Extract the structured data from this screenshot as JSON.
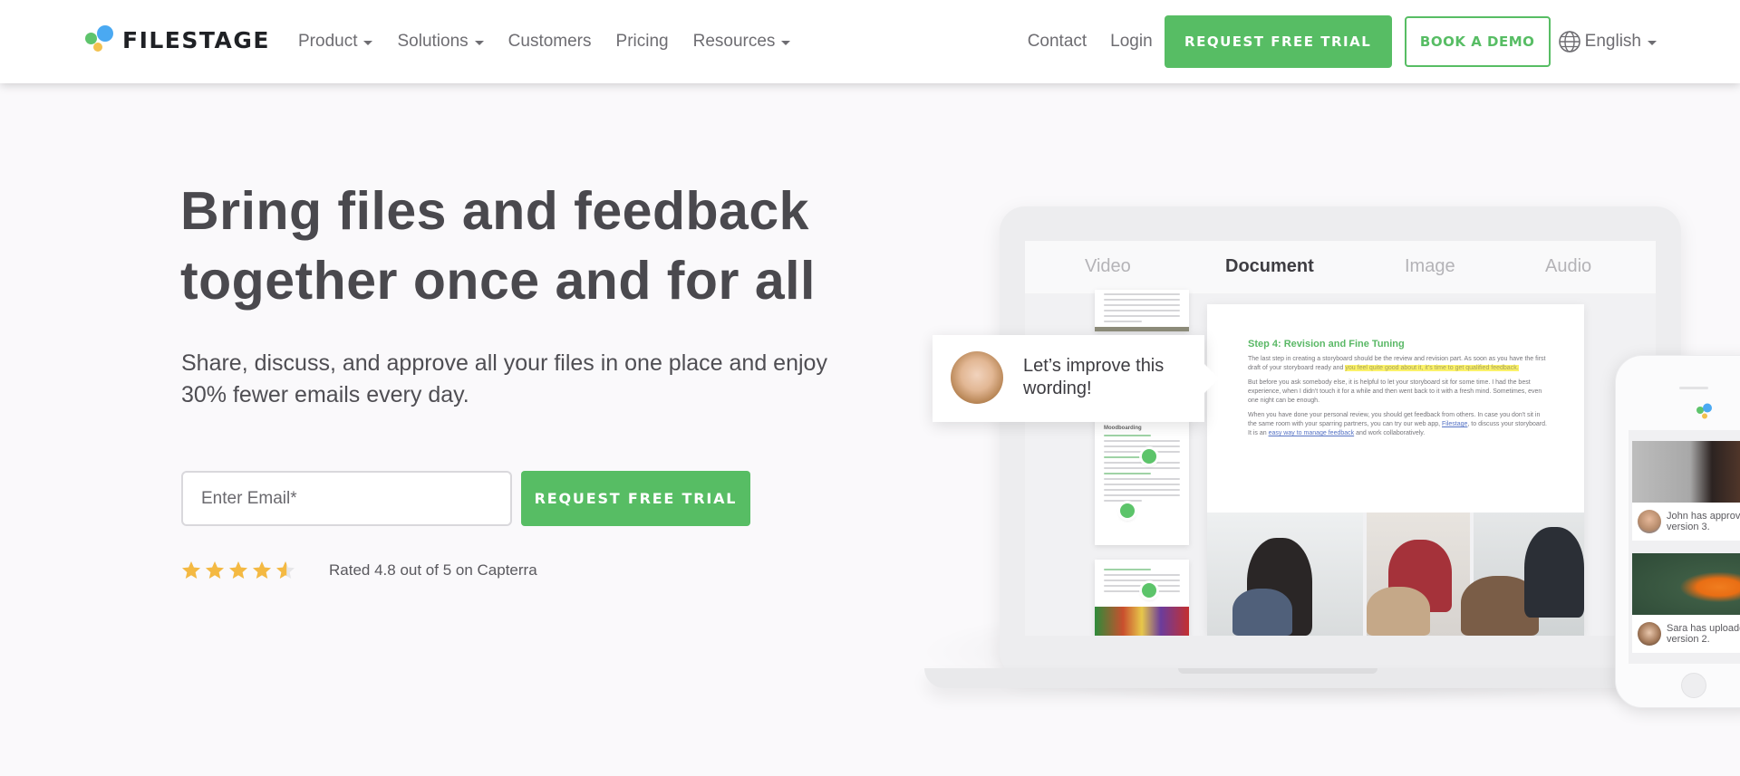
{
  "nav": {
    "logo_text": "FILESTAGE",
    "links": [
      {
        "label": "Product",
        "dropdown": true
      },
      {
        "label": "Solutions",
        "dropdown": true
      },
      {
        "label": "Customers",
        "dropdown": false
      },
      {
        "label": "Pricing",
        "dropdown": false
      },
      {
        "label": "Resources",
        "dropdown": true
      }
    ],
    "contact": "Contact",
    "login": "Login",
    "trial_button": "REQUEST FREE TRIAL",
    "demo_button": "BOOK A DEMO",
    "language": "English"
  },
  "hero": {
    "headline_line1": "Bring files and feedback",
    "headline_line2": "together once and for all",
    "subheadline": "Share, discuss, and approve all your files in one place and enjoy 30% fewer emails every day.",
    "email_placeholder": "Enter Email*",
    "email_value": "",
    "cta_button": "REQUEST FREE TRIAL",
    "rating": {
      "value": 4.8,
      "max": 5,
      "text": "Rated 4.8 out of 5 on Capterra"
    }
  },
  "mockup": {
    "tabs": [
      {
        "label": "Video",
        "active": false
      },
      {
        "label": "Document",
        "active": true
      },
      {
        "label": "Image",
        "active": false
      },
      {
        "label": "Audio",
        "active": false
      }
    ],
    "comment": "Let’s improve this wording!",
    "document": {
      "title": "Step 4: Revision and Fine Tuning",
      "p1_before": "The last step in creating a storyboard should be the review and revision part. As soon as you have the first draft of your storyboard ready and ",
      "p1_highlight": "you feel quite good about it, it's time to get qualified feedback.",
      "p2": "But before you ask somebody else, it is helpful to let your storyboard sit for some time. I had the best experience, when I didn't touch it for a while and then went back to it with a fresh mind. Sometimes, even one night can be enough.",
      "p3_before": "When you have done your personal review, you should get feedback from others. In case you don't sit in the same room with your sparring partners, you can try our web app, ",
      "p3_link1": "Filestage",
      "p3_mid": ", to discuss your storyboard. It is an ",
      "p3_link2": "easy way to manage feedback",
      "p3_after": " and work collaboratively."
    },
    "thumb_title": "Moodboarding",
    "phone_feed": [
      {
        "text_line1": "John has approved",
        "text_line2": "version 3."
      },
      {
        "text_line1": "Sara has uploaded",
        "text_line2": "version 2."
      }
    ]
  },
  "colors": {
    "brand_green": "#57bd64",
    "logo_blue": "#4aa9f2",
    "logo_green": "#5ec46c",
    "logo_yellow": "#f2c14e",
    "star": "#f4b942"
  }
}
